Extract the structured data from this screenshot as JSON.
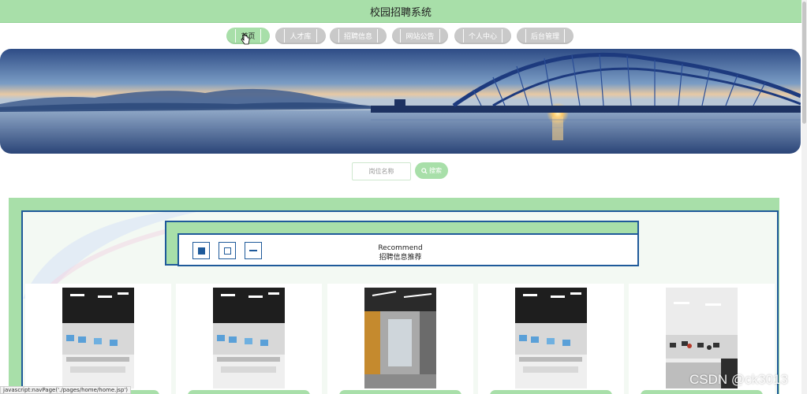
{
  "header": {
    "title": "校园招聘系统"
  },
  "nav": {
    "items": [
      {
        "label": "首页",
        "active": true
      },
      {
        "label": "人才库",
        "active": false
      },
      {
        "label": "招聘信息",
        "active": false
      },
      {
        "label": "网站公告",
        "active": false
      },
      {
        "label": "个人中心",
        "active": false
      },
      {
        "label": "后台管理",
        "active": false
      }
    ]
  },
  "search": {
    "placeholder": "岗位名称",
    "button_label": "搜索"
  },
  "recommend": {
    "title_en": "Recommend",
    "title_cn": "招聘信息推荐"
  },
  "status_bar": {
    "link": "javascript:navPage('./pages/home/home.jsp')"
  },
  "watermark": "CSDN @ck3013",
  "colors": {
    "accent": "#a8dfa9",
    "border_blue": "#1f5a9a",
    "inactive_nav": "#c9c9c9"
  },
  "icons": {
    "search": "search-icon",
    "cursor": "hand-cursor-icon"
  }
}
